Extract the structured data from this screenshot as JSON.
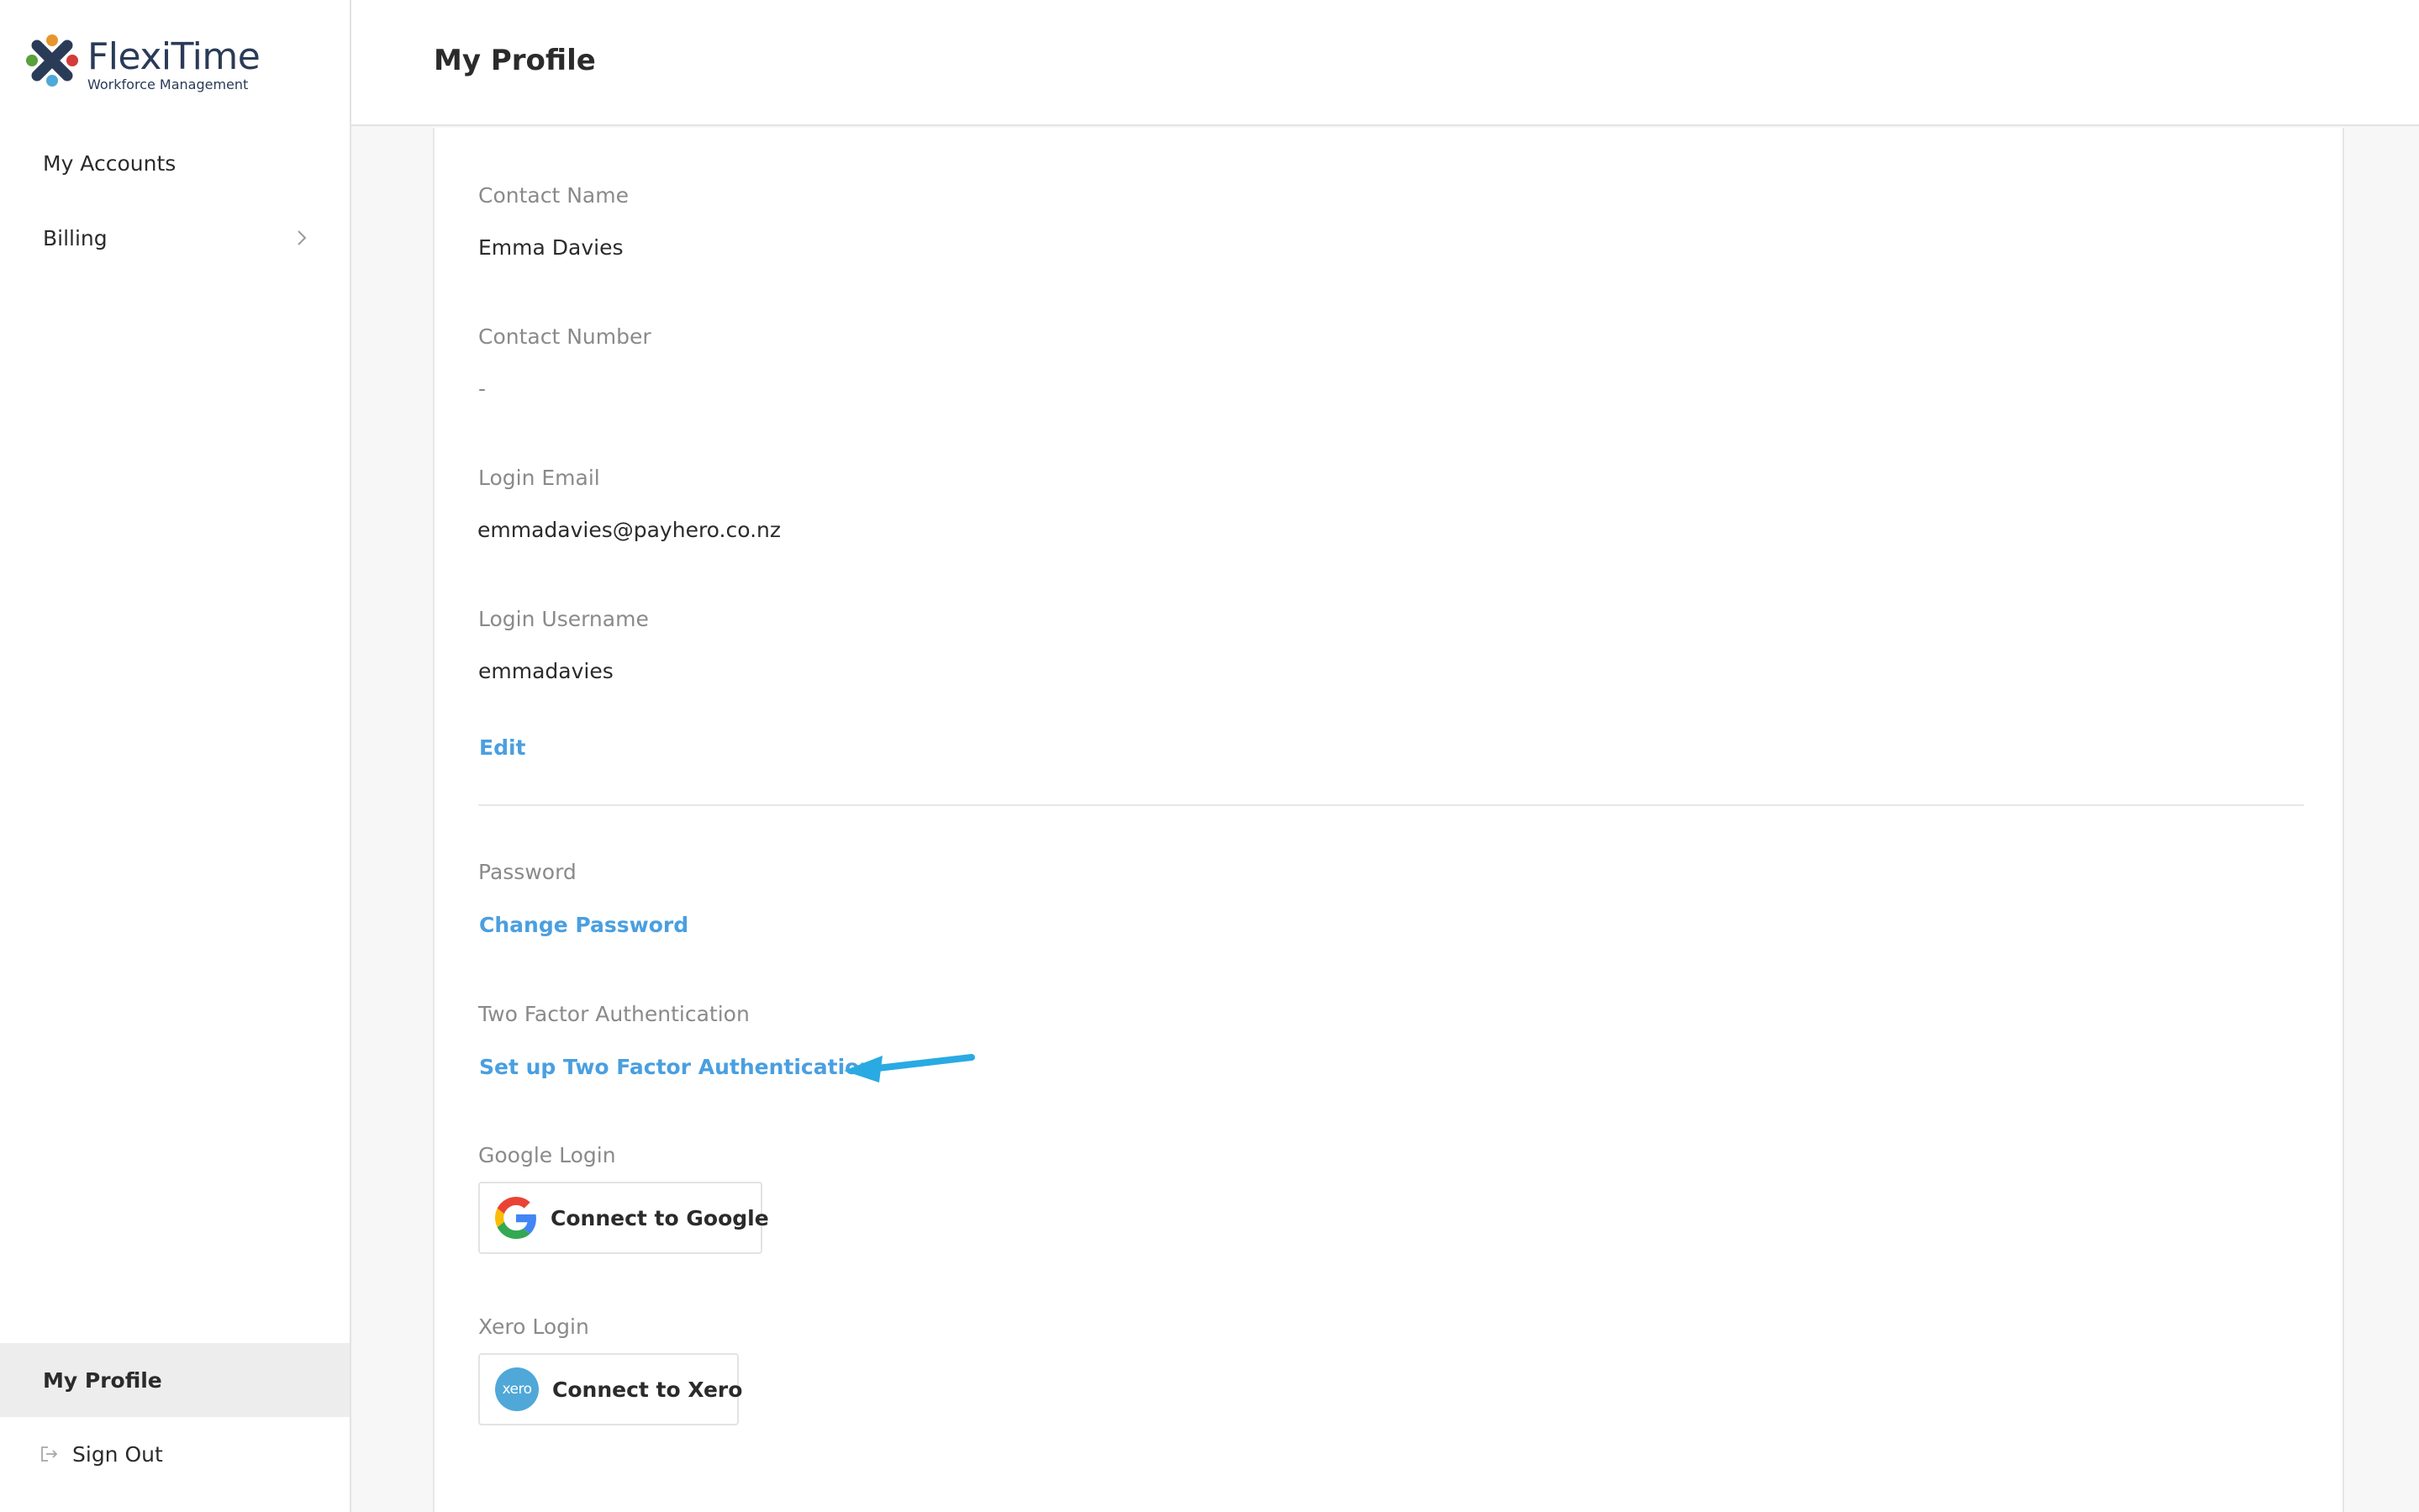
{
  "app": {
    "logo_name": "FlexiTime",
    "logo_tagline": "Workforce Management"
  },
  "sidebar": {
    "items": [
      {
        "label": "My Accounts"
      },
      {
        "label": "Billing"
      }
    ],
    "profile_label": "My Profile",
    "signout_label": "Sign Out"
  },
  "header": {
    "title": "My Profile"
  },
  "profile": {
    "contact_name_label": "Contact Name",
    "contact_name": "Emma Davies",
    "contact_number_label": "Contact Number",
    "contact_number": "-",
    "login_email_label": "Login Email",
    "login_email": "emmadavies@payhero.co.nz",
    "login_username_label": "Login Username",
    "login_username": "emmadavies",
    "edit_label": "Edit",
    "password_label": "Password",
    "change_password_label": "Change Password",
    "two_factor_label": "Two Factor Authentication",
    "two_factor_link": "Set up Two Factor Authentication",
    "google_login_label": "Google Login",
    "google_button_label": "Connect to Google",
    "xero_login_label": "Xero Login",
    "xero_button_label": "Connect to Xero",
    "xero_icon_text": "xero"
  },
  "colors": {
    "accent_link": "#4a9fe0",
    "annotation_arrow": "#29aae2",
    "xero_blue": "#4fa8d8"
  },
  "icons": {
    "billing_chevron": "chevron-right-icon",
    "signout": "sign-out-icon",
    "google": "google-g-icon",
    "xero": "xero-logo-icon",
    "annotation": "annotation-arrow-icon"
  }
}
